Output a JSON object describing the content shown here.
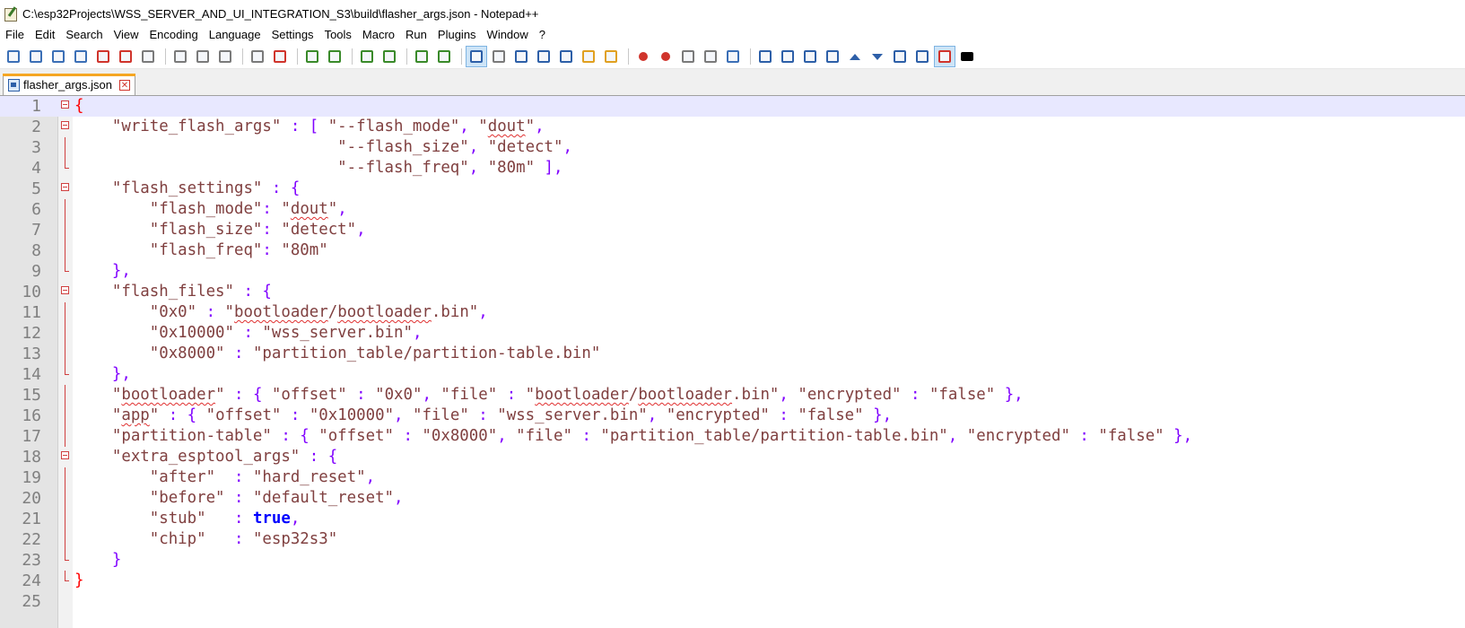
{
  "window": {
    "title": "C:\\esp32Projects\\WSS_SERVER_AND_UI_INTEGRATION_S3\\build\\flasher_args.json - Notepad++",
    "icon": "notepad-plus-plus-icon"
  },
  "menu": [
    "File",
    "Edit",
    "Search",
    "View",
    "Encoding",
    "Language",
    "Settings",
    "Tools",
    "Macro",
    "Run",
    "Plugins",
    "Window",
    "?"
  ],
  "toolbar": {
    "groups": [
      [
        "new-file-icon",
        "open-file-icon",
        "save-icon",
        "save-all-icon",
        "close-icon",
        "close-all-icon",
        "print-icon"
      ],
      [
        "cut-icon",
        "copy-icon",
        "paste-icon"
      ],
      [
        "undo-icon",
        "redo-icon"
      ],
      [
        "find-icon",
        "replace-icon"
      ],
      [
        "zoom-in-icon",
        "zoom-out-icon"
      ],
      [
        "sync-vertical-icon",
        "sync-horizontal-icon"
      ],
      [
        "word-wrap-icon",
        "show-all-chars-icon",
        "indent-guide-icon",
        "language-format-icon",
        "function-list-icon",
        "folder-workspace-icon",
        "monitoring-icon"
      ],
      [
        "record-macro-icon",
        "stop-record-icon",
        "play-macro-icon",
        "run-macro-multiple-icon",
        "save-macro-icon"
      ],
      [
        "plugin-insert-icon",
        "plugin-list-icon",
        "plugin-table-icon",
        "plugin-sort-icon",
        "up-arrow-icon",
        "down-arrow-icon",
        "plugin-collapse-icon",
        "plugin-view-icon",
        "spell-check-icon",
        "markdown-icon"
      ]
    ],
    "active": [
      "word-wrap-icon",
      "spell-check-icon"
    ],
    "colors": {
      "save": "#3b6fb6",
      "red": "#d0342c",
      "green": "#3a8a2a",
      "blue": "#2d5fa8",
      "gray": "#7a7a7a",
      "orange": "#e0a020"
    }
  },
  "tab": {
    "label": "flasher_args.json",
    "icon": "save-file-tab-icon",
    "close_icon": "tab-close-icon"
  },
  "editor": {
    "current_line": 1,
    "lines": [
      {
        "n": "1",
        "fold": "box",
        "t": [
          [
            "b",
            "{"
          ]
        ]
      },
      {
        "n": "2",
        "fold": "box",
        "t": [
          [
            "s",
            "    \"write_flash_args\" "
          ],
          [
            "o",
            ": [ "
          ],
          [
            "s",
            "\"--flash_mode\""
          ],
          [
            "o",
            ", "
          ],
          [
            "s",
            "\""
          ],
          [
            "sq",
            "dout"
          ],
          [
            "s",
            "\""
          ],
          [
            "o",
            ","
          ]
        ]
      },
      {
        "n": "3",
        "fold": "vline",
        "t": [
          [
            "s",
            "                            \"--flash_size\""
          ],
          [
            "o",
            ", "
          ],
          [
            "s",
            "\"detect\""
          ],
          [
            "o",
            ","
          ]
        ]
      },
      {
        "n": "4",
        "fold": "end",
        "t": [
          [
            "s",
            "                            \"--flash_freq\""
          ],
          [
            "o",
            ", "
          ],
          [
            "s",
            "\"80m\" "
          ],
          [
            "o",
            "],"
          ]
        ]
      },
      {
        "n": "5",
        "fold": "box",
        "t": [
          [
            "s",
            "    \"flash_settings\" "
          ],
          [
            "o",
            ": {"
          ]
        ]
      },
      {
        "n": "6",
        "fold": "vline",
        "t": [
          [
            "s",
            "        \"flash_mode\""
          ],
          [
            "o",
            ": "
          ],
          [
            "s",
            "\""
          ],
          [
            "sq",
            "dout"
          ],
          [
            "s",
            "\""
          ],
          [
            "o",
            ","
          ]
        ]
      },
      {
        "n": "7",
        "fold": "vline",
        "t": [
          [
            "s",
            "        \"flash_size\""
          ],
          [
            "o",
            ": "
          ],
          [
            "s",
            "\"detect\""
          ],
          [
            "o",
            ","
          ]
        ]
      },
      {
        "n": "8",
        "fold": "vline",
        "t": [
          [
            "s",
            "        \"flash_freq\""
          ],
          [
            "o",
            ": "
          ],
          [
            "s",
            "\"80m\""
          ]
        ]
      },
      {
        "n": "9",
        "fold": "end",
        "t": [
          [
            "o",
            "    },"
          ]
        ]
      },
      {
        "n": "10",
        "fold": "box",
        "t": [
          [
            "s",
            "    \"flash_files\" "
          ],
          [
            "o",
            ": {"
          ]
        ]
      },
      {
        "n": "11",
        "fold": "vline",
        "t": [
          [
            "s",
            "        \"0x0\" "
          ],
          [
            "o",
            ": "
          ],
          [
            "s",
            "\""
          ],
          [
            "sq",
            "bootloader"
          ],
          [
            "s",
            "/"
          ],
          [
            "sq",
            "bootloader"
          ],
          [
            "s",
            ".bin\""
          ],
          [
            "o",
            ","
          ]
        ]
      },
      {
        "n": "12",
        "fold": "vline",
        "t": [
          [
            "s",
            "        \"0x10000\" "
          ],
          [
            "o",
            ": "
          ],
          [
            "s",
            "\"wss_server.bin\""
          ],
          [
            "o",
            ","
          ]
        ]
      },
      {
        "n": "13",
        "fold": "vline",
        "t": [
          [
            "s",
            "        \"0x8000\" "
          ],
          [
            "o",
            ": "
          ],
          [
            "s",
            "\"partition_table/partition-table.bin\""
          ]
        ]
      },
      {
        "n": "14",
        "fold": "end",
        "t": [
          [
            "o",
            "    },"
          ]
        ]
      },
      {
        "n": "15",
        "fold": "vline",
        "t": [
          [
            "s",
            "    \""
          ],
          [
            "sq",
            "bootloader"
          ],
          [
            "s",
            "\" "
          ],
          [
            "o",
            ": { "
          ],
          [
            "s",
            "\"offset\" "
          ],
          [
            "o",
            ": "
          ],
          [
            "s",
            "\"0x0\""
          ],
          [
            "o",
            ", "
          ],
          [
            "s",
            "\"file\" "
          ],
          [
            "o",
            ": "
          ],
          [
            "s",
            "\""
          ],
          [
            "sq",
            "bootloader"
          ],
          [
            "s",
            "/"
          ],
          [
            "sq",
            "bootloader"
          ],
          [
            "s",
            ".bin\""
          ],
          [
            "o",
            ", "
          ],
          [
            "s",
            "\"encrypted\" "
          ],
          [
            "o",
            ": "
          ],
          [
            "s",
            "\"false\" "
          ],
          [
            "o",
            "},"
          ]
        ]
      },
      {
        "n": "16",
        "fold": "vline",
        "t": [
          [
            "s",
            "    \""
          ],
          [
            "sq",
            "app"
          ],
          [
            "s",
            "\" "
          ],
          [
            "o",
            ": { "
          ],
          [
            "s",
            "\"offset\" "
          ],
          [
            "o",
            ": "
          ],
          [
            "s",
            "\"0x10000\""
          ],
          [
            "o",
            ", "
          ],
          [
            "s",
            "\"file\" "
          ],
          [
            "o",
            ": "
          ],
          [
            "s",
            "\"wss_server.bin\""
          ],
          [
            "o",
            ", "
          ],
          [
            "s",
            "\"encrypted\" "
          ],
          [
            "o",
            ": "
          ],
          [
            "s",
            "\"false\" "
          ],
          [
            "o",
            "},"
          ]
        ]
      },
      {
        "n": "17",
        "fold": "vline",
        "t": [
          [
            "s",
            "    \"partition-table\" "
          ],
          [
            "o",
            ": { "
          ],
          [
            "s",
            "\"offset\" "
          ],
          [
            "o",
            ": "
          ],
          [
            "s",
            "\"0x8000\""
          ],
          [
            "o",
            ", "
          ],
          [
            "s",
            "\"file\" "
          ],
          [
            "o",
            ": "
          ],
          [
            "s",
            "\"partition_table/partition-table.bin\""
          ],
          [
            "o",
            ", "
          ],
          [
            "s",
            "\"encrypted\" "
          ],
          [
            "o",
            ": "
          ],
          [
            "s",
            "\"false\" "
          ],
          [
            "o",
            "},"
          ]
        ]
      },
      {
        "n": "18",
        "fold": "box",
        "t": [
          [
            "s",
            "    \"extra_esptool_args\" "
          ],
          [
            "o",
            ": {"
          ]
        ]
      },
      {
        "n": "19",
        "fold": "vline",
        "t": [
          [
            "s",
            "        \"after\"  "
          ],
          [
            "o",
            ": "
          ],
          [
            "s",
            "\"hard_reset\""
          ],
          [
            "o",
            ","
          ]
        ]
      },
      {
        "n": "20",
        "fold": "vline",
        "t": [
          [
            "s",
            "        \"before\" "
          ],
          [
            "o",
            ": "
          ],
          [
            "s",
            "\"default_reset\""
          ],
          [
            "o",
            ","
          ]
        ]
      },
      {
        "n": "21",
        "fold": "vline",
        "t": [
          [
            "s",
            "        \"stub\"   "
          ],
          [
            "o",
            ": "
          ],
          [
            "k",
            "true"
          ],
          [
            "o",
            ","
          ]
        ]
      },
      {
        "n": "22",
        "fold": "vline",
        "t": [
          [
            "s",
            "        \"chip\"   "
          ],
          [
            "o",
            ": "
          ],
          [
            "s",
            "\"esp32s3\""
          ]
        ]
      },
      {
        "n": "23",
        "fold": "end",
        "t": [
          [
            "o",
            "    }"
          ]
        ]
      },
      {
        "n": "24",
        "fold": "end",
        "t": [
          [
            "b",
            "}"
          ]
        ]
      },
      {
        "n": "25",
        "fold": "",
        "t": []
      }
    ]
  }
}
